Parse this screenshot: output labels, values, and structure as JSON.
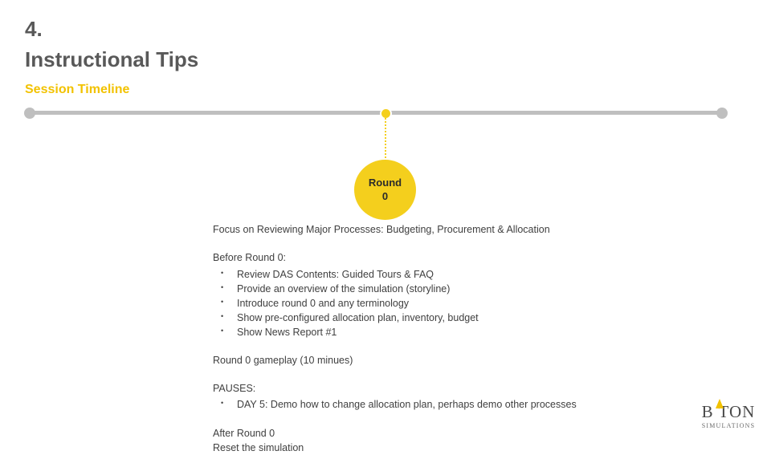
{
  "header": {
    "number": "4.",
    "title": "Instructional Tips",
    "subtitle": "Session Timeline"
  },
  "timeline": {
    "marker_label_line1": "Round",
    "marker_label_line2": "0"
  },
  "content": {
    "focus_line": "Focus on Reviewing Major Processes: Budgeting, Procurement & Allocation",
    "before_label": "Before Round 0:",
    "before_bullets": [
      "Review DAS Contents: Guided Tours & FAQ",
      "Provide an overview of the simulation (storyline)",
      "Introduce round 0 and any terminology",
      "Show pre-configured allocation plan, inventory, budget",
      "Show News Report #1"
    ],
    "gameplay_line": "Round 0 gameplay (10 minues)",
    "pauses_label": "PAUSES:",
    "pauses_bullets": [
      "DAY 5: Demo how to change allocation plan, perhaps demo other processes"
    ],
    "after_label": "After Round 0",
    "after_line": "Reset the simulation"
  },
  "logo": {
    "word": "B TON",
    "sub": "SIMULATIONS"
  },
  "colors": {
    "accent": "#f4cf1d",
    "subtitle": "#f2c200",
    "timeline_gray": "#bfbfbf",
    "text": "#3f3f3f"
  }
}
